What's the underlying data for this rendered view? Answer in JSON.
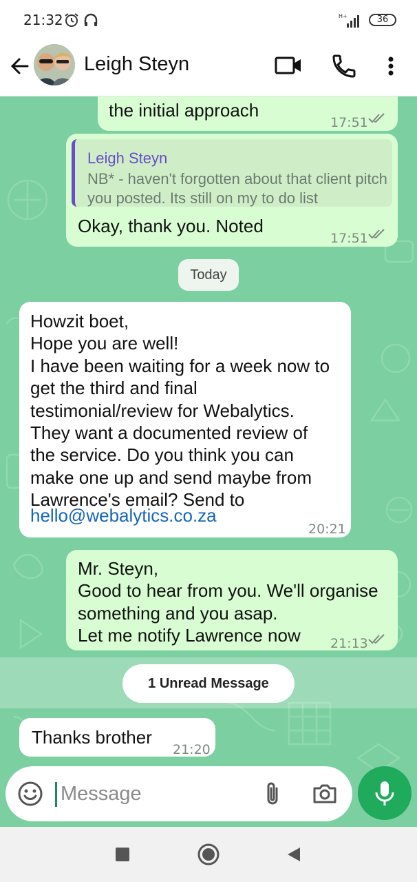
{
  "status_bar": {
    "time": "21:32",
    "network": "H+",
    "battery": "36"
  },
  "header": {
    "contact_name": "Leigh Steyn"
  },
  "messages": [
    {
      "direction": "outgoing",
      "text": "the initial approach",
      "time": "17:51",
      "status": "read"
    },
    {
      "direction": "outgoing",
      "quoted_author": "Leigh Steyn",
      "quoted_text": "NB* - haven't forgotten about that client pitch you posted. Its still on my to do list",
      "text": "Okay, thank you. Noted",
      "time": "17:51",
      "status": "read"
    },
    {
      "direction": "incoming",
      "text": "Howzit boet,\nHope you are well!\nI have been waiting for a week now to get the third and final testimonial/review for Webalytics. They want a documented review of the service. Do you think you can make one up and send maybe from Lawrence's email? Send to",
      "link": "hello@webalytics.co.za",
      "time": "20:21"
    },
    {
      "direction": "outgoing",
      "text": "Mr. Steyn,\nGood to hear from you. We'll organise something and you asap.\nLet me notify Lawrence now",
      "time": "21:13",
      "status": "read"
    },
    {
      "direction": "incoming",
      "text": "Thanks brother",
      "time": "21:20"
    }
  ],
  "day_separator": "Today",
  "unread_label": "1 Unread Message",
  "composer": {
    "placeholder": "Message"
  },
  "colors": {
    "chat_background": "#7ccfa0",
    "outgoing_bubble": "#d9fdd3",
    "incoming_bubble": "#ffffff",
    "accent": "#1faa5c",
    "quote_author": "#6a4cc7",
    "link": "#1466b8"
  },
  "icons": [
    "alarm-icon",
    "headphones-icon",
    "signal-icon",
    "battery-icon",
    "back-arrow-icon",
    "video-call-icon",
    "phone-icon",
    "more-vert-icon",
    "double-check-icon",
    "emoji-icon",
    "attach-icon",
    "camera-icon",
    "mic-icon",
    "nav-recents-icon",
    "nav-home-icon",
    "nav-back-icon"
  ]
}
